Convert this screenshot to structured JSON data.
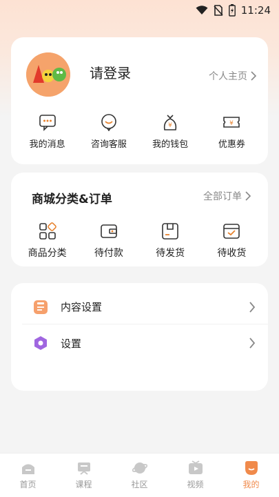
{
  "status_bar": {
    "time": "11:24"
  },
  "profile": {
    "login_label": "请登录",
    "home_link": "个人主页",
    "quick_actions": [
      {
        "label": "我的消息",
        "icon": "message-icon"
      },
      {
        "label": "咨询客服",
        "icon": "customer-service-icon"
      },
      {
        "label": "我的钱包",
        "icon": "wallet-icon"
      },
      {
        "label": "优惠券",
        "icon": "coupon-icon"
      }
    ]
  },
  "orders": {
    "title": "商城分类&订单",
    "all_orders": "全部订单",
    "items": [
      {
        "label": "商品分类",
        "icon": "category-icon"
      },
      {
        "label": "待付款",
        "icon": "pending-payment-icon"
      },
      {
        "label": "待发货",
        "icon": "pending-shipment-icon"
      },
      {
        "label": "待收货",
        "icon": "pending-receipt-icon"
      }
    ]
  },
  "settings": {
    "items": [
      {
        "label": "内容设置",
        "icon": "content-settings-icon"
      },
      {
        "label": "设置",
        "icon": "settings-icon"
      }
    ]
  },
  "tabbar": {
    "active": "我的",
    "tabs": [
      {
        "label": "首页",
        "icon": "home-icon"
      },
      {
        "label": "课程",
        "icon": "course-icon"
      },
      {
        "label": "社区",
        "icon": "community-icon"
      },
      {
        "label": "视频",
        "icon": "video-icon"
      },
      {
        "label": "我的",
        "icon": "mine-icon"
      }
    ]
  },
  "colors": {
    "accent": "#f08a4b",
    "icon_orange": "#e7832f"
  }
}
